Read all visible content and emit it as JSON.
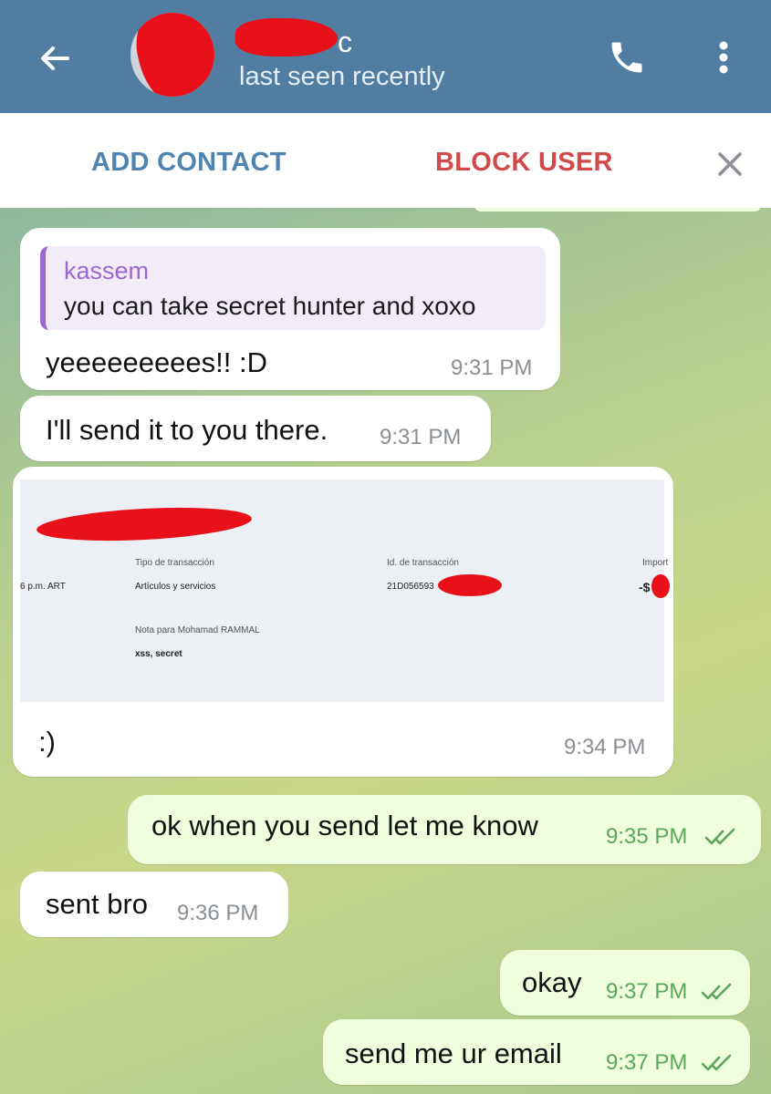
{
  "header": {
    "name_visible_char": "c",
    "status": "last seen recently"
  },
  "actions": {
    "add_contact": "ADD CONTACT",
    "block_user": "BLOCK USER"
  },
  "messages": {
    "m1": {
      "quote_name": "kassem",
      "quote_text": "you can take secret hunter and xoxo",
      "text": "yeeeeeeeees!! :D",
      "time": "9:31 PM"
    },
    "m2": {
      "text": "I'll send it to you there.",
      "time": "9:31 PM"
    },
    "m3": {
      "caption": ":)",
      "time": "9:34 PM",
      "receipt": {
        "col1_header": "Tipo de transacción",
        "col2_header": "Id. de transacción",
        "col3_header": "Import",
        "date_tail": "6 p.m. ART",
        "type_value": "Artículos y servicios",
        "id_value": "21D056593",
        "amount_value": "-$",
        "note_label": "Nota para Mohamad RAMMAL",
        "note_value": "xss, secret"
      }
    },
    "m4": {
      "text": "ok when you send let me know",
      "time": "9:35 PM"
    },
    "m5": {
      "text": "sent bro",
      "time": "9:36 PM"
    },
    "m6": {
      "text": "okay",
      "time": "9:37 PM"
    },
    "m7": {
      "text": "send me ur email",
      "time": "9:37 PM"
    }
  },
  "colors": {
    "header": "#517da2",
    "add_contact": "#4f83b0",
    "block_user": "#d24949",
    "outgoing_bubble": "#effedd",
    "quote_accent": "#9c67d0",
    "read_ticks": "#5ba65a"
  },
  "icons": [
    "back-arrow-icon",
    "phone-icon",
    "more-vertical-icon",
    "close-icon",
    "double-check-icon"
  ]
}
